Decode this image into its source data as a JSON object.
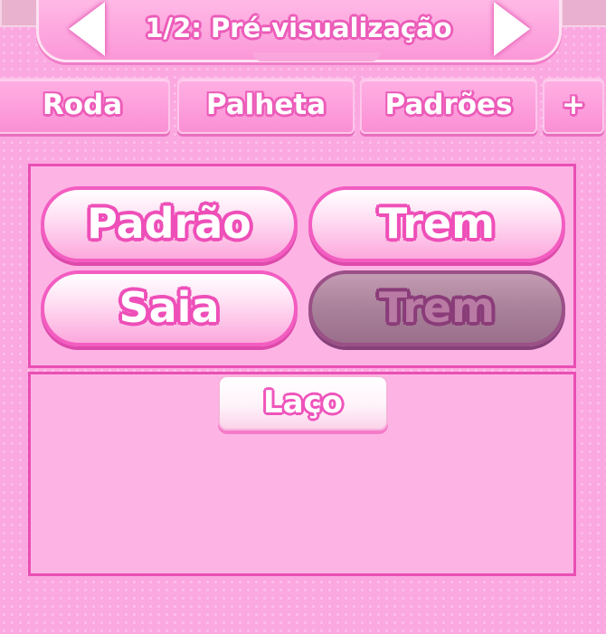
{
  "header": {
    "title": "1/2: Pré-visualização",
    "prev_icon": "arrow-left-icon",
    "next_icon": "arrow-right-icon"
  },
  "tabs": [
    {
      "label": "Roda"
    },
    {
      "label": "Palheta"
    },
    {
      "label": "Padrões"
    },
    {
      "label": "+"
    }
  ],
  "options": [
    {
      "label": "Padrão",
      "selected": false
    },
    {
      "label": "Trem",
      "selected": false
    },
    {
      "label": "Saia",
      "selected": false
    },
    {
      "label": "Trem",
      "selected": true
    }
  ],
  "accessory": {
    "label": "Laço"
  },
  "colors": {
    "background": "#fba8e0",
    "accent": "#ec5cb9",
    "selected": "#a9819a"
  }
}
